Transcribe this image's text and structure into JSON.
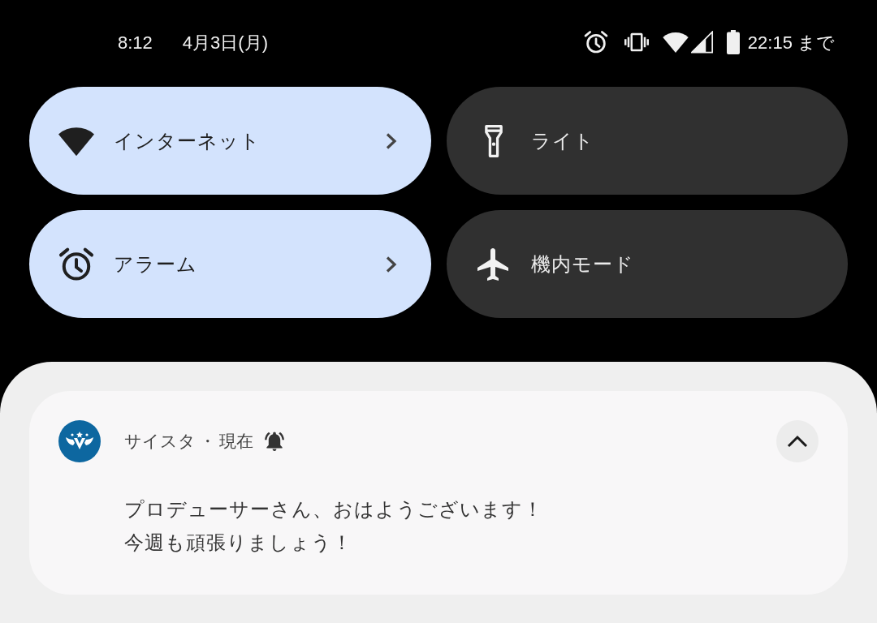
{
  "status_bar": {
    "time": "8:12",
    "date": "4月3日(月)",
    "battery_text": "22:15 まで"
  },
  "quick_settings": [
    {
      "kind": "internet",
      "label": "インターネット",
      "on": true,
      "chevron": true
    },
    {
      "kind": "flashlight",
      "label": "ライト",
      "on": false,
      "chevron": false
    },
    {
      "kind": "alarm",
      "label": "アラーム",
      "on": true,
      "chevron": true
    },
    {
      "kind": "airplane",
      "label": "機内モード",
      "on": false,
      "chevron": false
    }
  ],
  "notification": {
    "app_name": "サイスタ",
    "separator": "・",
    "time": "現在",
    "alerting": true,
    "expanded": true,
    "lines": [
      "プロデューサーさん、おはようございます！",
      "今週も頑張りましょう！"
    ]
  }
}
